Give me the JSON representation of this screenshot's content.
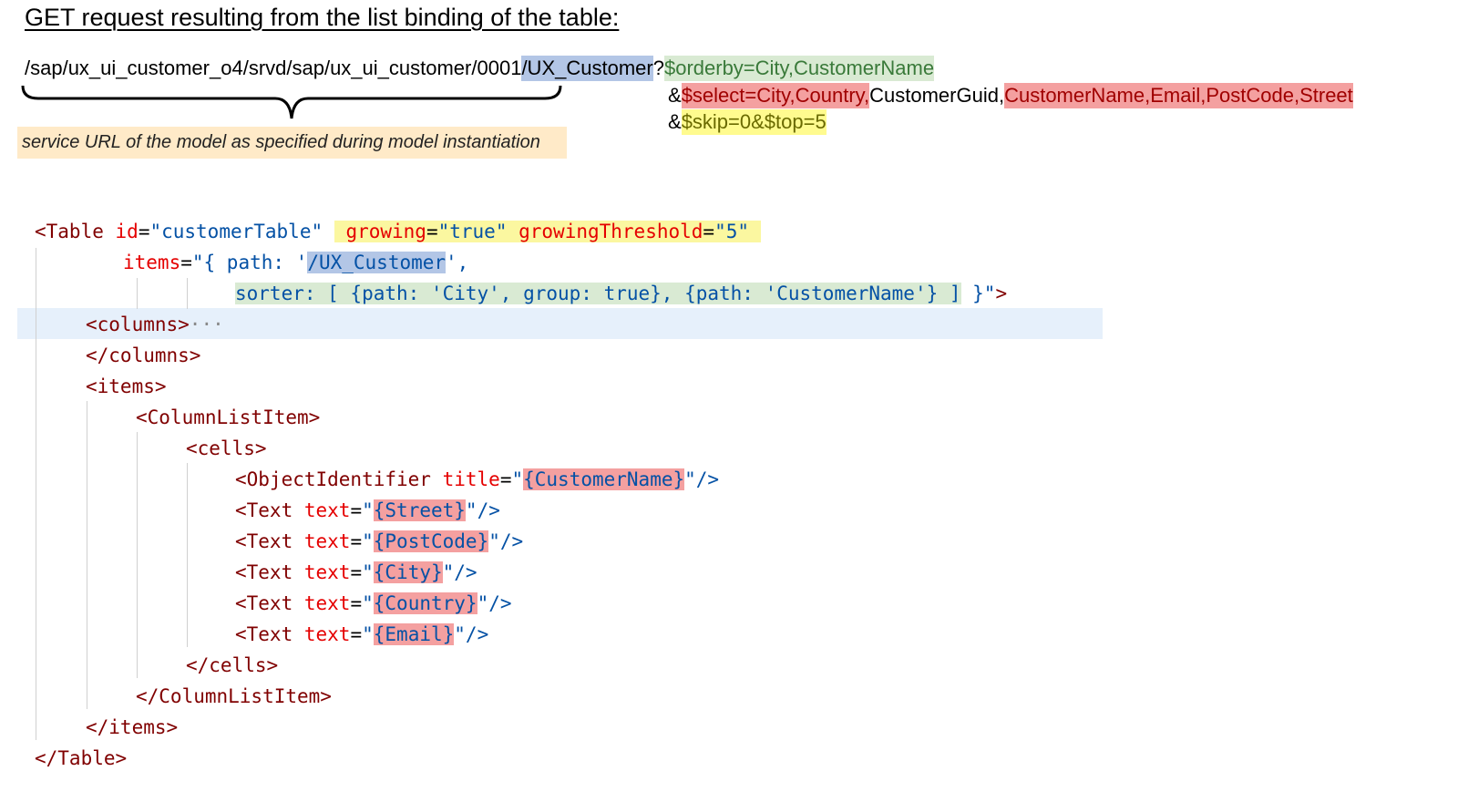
{
  "heading": "GET request resulting from the list binding of the table:",
  "url": {
    "base": "/sap/ux_ui_customer_o4/srvd/sap/ux_ui_customer/0001",
    "entity": "/UX_Customer",
    "qmark": "?",
    "orderby": "$orderby=City,CustomerName",
    "amp1": "&",
    "select_hl": "$select=City,Country,",
    "select_plain": "CustomerGuid,",
    "select_hl2": "CustomerName,Email,PostCode,Street",
    "amp2": "&",
    "paging": "$skip=0&$top=5"
  },
  "note": "service URL of the model as specified during model instantiation",
  "colors": {
    "blue_highlight": "#b3c6e6",
    "green_highlight": "#d9ead3",
    "red_highlight": "#f4a0a0",
    "yellow_highlight": "#fffb8f",
    "note_bg": "#ffeac8",
    "line_highlight": "#e6f0fb"
  },
  "code": {
    "table_open": "<Table",
    "id_attr": "id",
    "id_val": "\"customerTable\"",
    "growing_attr": "growing",
    "growing_val": "\"true\"",
    "threshold_attr": "growingThreshold",
    "threshold_val": "\"5\"",
    "items_attr": "items",
    "items_val_start": "\"{ path: '",
    "items_path": "/UX_Customer",
    "items_val_end": "',",
    "sorter": "sorter: [ {path: 'City', group: true}, {path: 'CustomerName'} ]",
    "sorter_end": " }\"",
    "gt": ">",
    "columns_open": "<columns>",
    "ellipsis": "···",
    "columns_close": "</columns>",
    "items_open": "<items>",
    "cli_open": "<ColumnListItem>",
    "cells_open": "<cells>",
    "oi_tag": "<ObjectIdentifier",
    "title_attr": "title",
    "text_tag": "<Text",
    "text_attr": "text",
    "bind_customername": "{CustomerName}",
    "bind_street": "{Street}",
    "bind_postcode": "{PostCode}",
    "bind_city": "{City}",
    "bind_country": "{Country}",
    "bind_email": "{Email}",
    "self_close": "\"/>",
    "cells_close": "</cells>",
    "cli_close": "</ColumnListItem>",
    "items_close": "</items>",
    "table_close": "</Table>"
  }
}
